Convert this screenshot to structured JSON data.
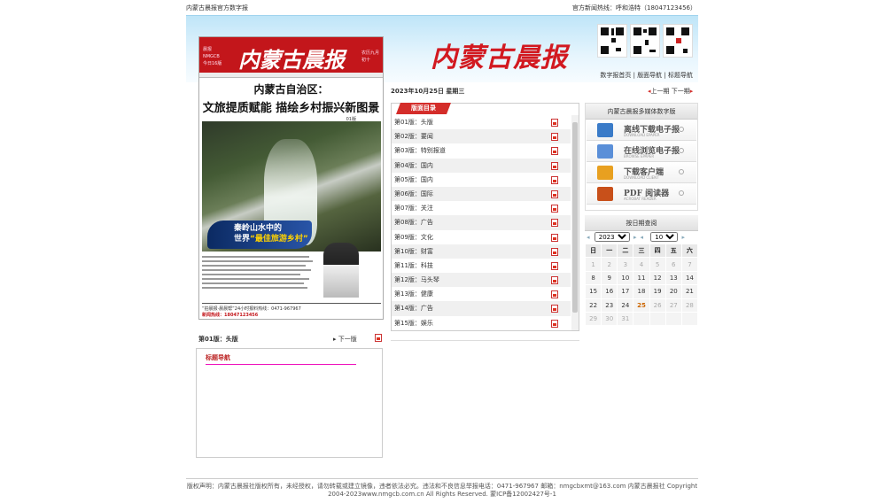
{
  "topbar": {
    "left_text": "内蒙古晨报官方数字报",
    "right_text": "官方新闻热线：呼和浩特（18047123456）"
  },
  "header": {
    "masthead": "内蒙古晨报",
    "nav": [
      "数字报首页",
      "版面导航",
      "标题导航"
    ]
  },
  "paper": {
    "masthead": "内蒙古晨报",
    "headline1": "内蒙古自治区：",
    "headline2": "文旅提质赋能 描绘乡村振兴新图景",
    "kicker": "01版",
    "ribbon_line1": "秦岭山水中的",
    "ribbon_line2a": "世界",
    "ribbon_line2b": "“最佳旅游乡村”",
    "footer_text": "“拍晨报·晨晨帮”24小时报料热线：0471-967967",
    "footer_text2": "新闻热线：18047123456"
  },
  "page_nav": {
    "current": "第01版：头版",
    "next": "下一版"
  },
  "title_nav": {
    "label": "标题导航"
  },
  "date": "2023年10月25日 星期三",
  "prev_next": {
    "prev": "上一期",
    "next": "下一期"
  },
  "directory": {
    "tab": "版面目录",
    "items": [
      "第01版：头版",
      "第02版：要闻",
      "第03版：特别报道",
      "第04版：国内",
      "第05版：国内",
      "第06版：国际",
      "第07版：关注",
      "第08版：广告",
      "第09版：文化",
      "第10版：财富",
      "第11版：科技",
      "第12版：马头琴",
      "第13版：健康",
      "第14版：广告",
      "第15版：娱乐"
    ]
  },
  "media": {
    "title": "内蒙古晨报多媒体数字版",
    "downloads": [
      {
        "label": "离线下载电子报",
        "sub": "DOWNLOAD EPAPER",
        "color": "#3a7bc8"
      },
      {
        "label": "在线浏览电子报",
        "sub": "BROWSE EPAPER",
        "color": "#5a8fd8"
      },
      {
        "label": "下载客户端",
        "sub": "DOWNLOAD CLIENT",
        "color": "#e8a020"
      },
      {
        "label": "PDF 阅读器",
        "sub": "ACROBAT READER",
        "color": "#c8501a"
      }
    ]
  },
  "calendar": {
    "title": "按日期查阅",
    "year": "2023",
    "month": "10",
    "weekdays": [
      "日",
      "一",
      "二",
      "三",
      "四",
      "五",
      "六"
    ],
    "weeks": [
      [
        "1",
        "2",
        "3",
        "4",
        "5",
        "6",
        "7"
      ],
      [
        "8",
        "9",
        "10",
        "11",
        "12",
        "13",
        "14"
      ],
      [
        "15",
        "16",
        "17",
        "18",
        "19",
        "20",
        "21"
      ],
      [
        "22",
        "23",
        "24",
        "25",
        "26",
        "27",
        "28"
      ],
      [
        "29",
        "30",
        "31",
        "",
        "",
        "",
        ""
      ]
    ]
  },
  "footer": {
    "line1": "版权声明：内蒙古晨报社版权所有，未经授权，请勿转载或建立镜像，违者依法必究。违法和不良信息举报电话：0471-967967 邮箱：nmgcbxmt@163.com 内蒙古晨报社 Copyright",
    "line2": "2004-2023www.nmgcb.com.cn All Rights Reserved. 蒙ICP备12002427号-1"
  }
}
